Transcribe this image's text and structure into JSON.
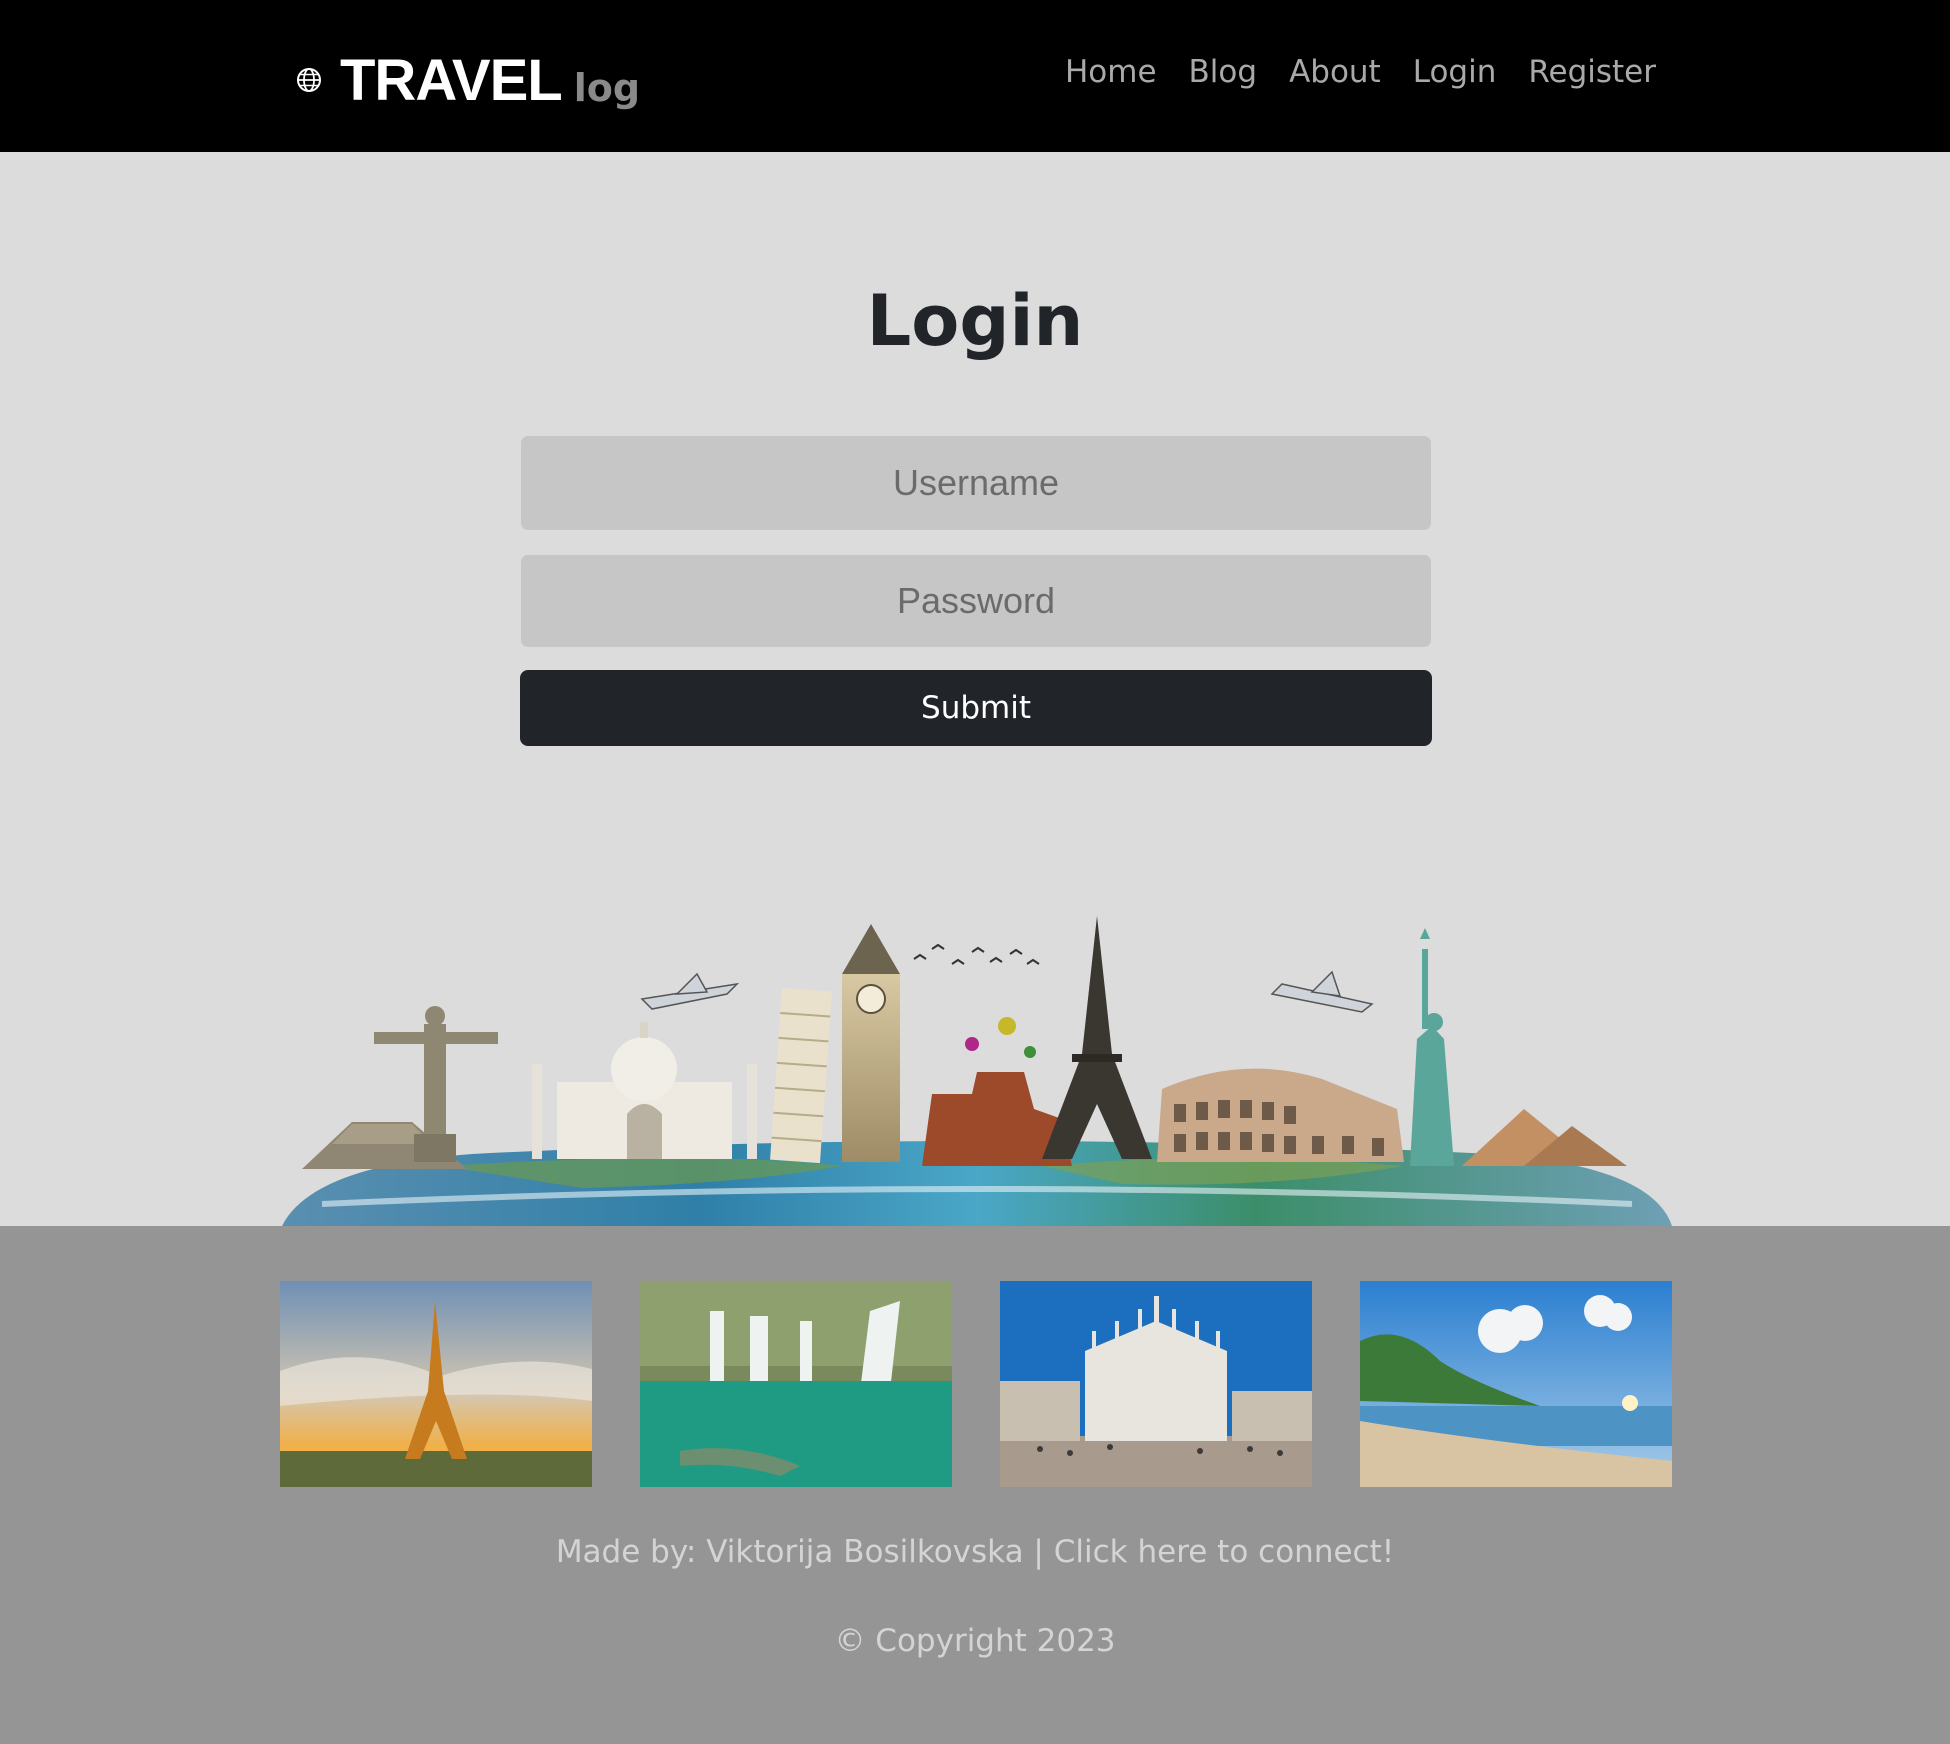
{
  "navbar": {
    "brand_name": "TRAVEL",
    "brand_suffix": "log",
    "links": [
      "Home",
      "Blog",
      "About",
      "Login",
      "Register"
    ]
  },
  "login": {
    "title": "Login",
    "username_placeholder": "Username",
    "password_placeholder": "Password",
    "submit_label": "Submit"
  },
  "hero_image": {
    "icon": "world-landmarks-illustration"
  },
  "gallery": [
    {
      "icon": "eiffel-tower-photo"
    },
    {
      "icon": "waterfall-lake-photo"
    },
    {
      "icon": "milan-cathedral-photo"
    },
    {
      "icon": "tropical-beach-photo"
    }
  ],
  "footer": {
    "made_by_prefix": "Made by: Viktorija Bosilkovska | ",
    "connect_link": "Click here to connect!",
    "copyright": "© Copyright 2023"
  },
  "colors": {
    "navbar_bg": "#000000",
    "main_bg": "#dcdcdc",
    "footer_bg": "#959595",
    "button_bg": "#212529"
  }
}
